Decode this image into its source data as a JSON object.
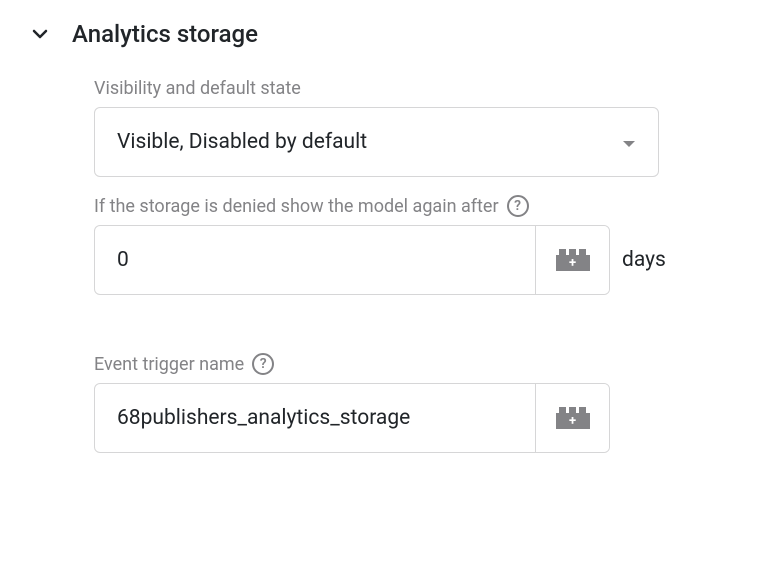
{
  "section": {
    "title": "Analytics storage"
  },
  "visibility": {
    "label": "Visibility and default state",
    "value": "Visible, Disabled by default"
  },
  "denied": {
    "label": "If the storage is denied show the model again after",
    "value": "0",
    "unit": "days"
  },
  "event_trigger": {
    "label": "Event trigger name",
    "value": "68publishers_analytics_storage"
  }
}
